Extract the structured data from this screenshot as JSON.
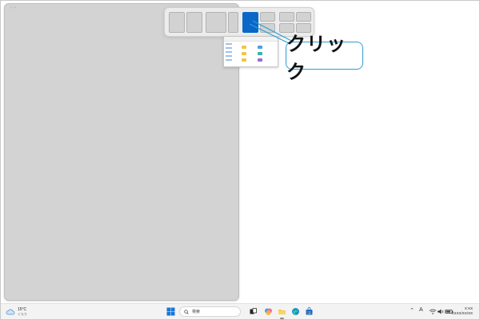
{
  "callout": {
    "label": "クリック"
  },
  "taskbar": {
    "weather": {
      "temp": "15°C",
      "desc": "くもり"
    },
    "search_placeholder": "検索",
    "tray": {
      "ime": "A"
    },
    "clock": {
      "time": "X:XX",
      "date": "XXXX/XX/XX"
    }
  },
  "snap_layouts": {
    "layouts": [
      "two-halves",
      "wide-left-narrow-right",
      "left-half-right-quarters",
      "four-quarters"
    ],
    "selected_zone": "layout-3-left-half",
    "accent_color": "#0a67c8"
  },
  "colors": {
    "callout_border": "#2a9fd6",
    "placeholder_window": "#d3d3d3"
  }
}
